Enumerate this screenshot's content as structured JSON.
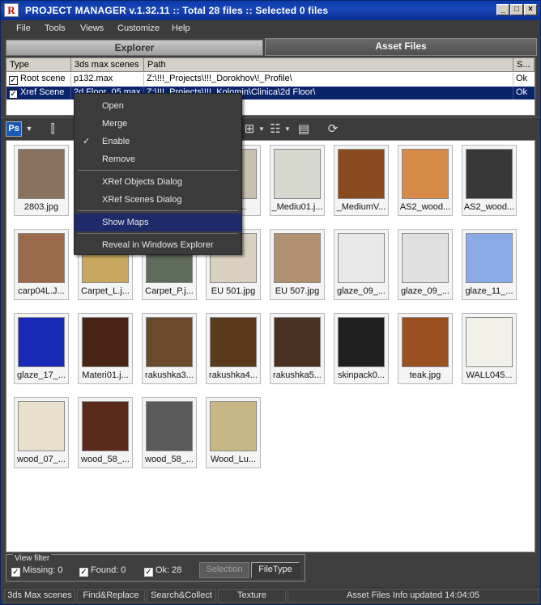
{
  "window": {
    "logo": "R",
    "title": "PROJECT MANAGER v.1.32.11   :: Total 28 files  :: Selected 0 files",
    "minimize": "_",
    "maximize": "□",
    "close": "×"
  },
  "menu": [
    "File",
    "Tools",
    "Views",
    "Customize",
    "Help"
  ],
  "tabs": {
    "explorer": "Explorer",
    "assets": "Asset Files"
  },
  "grid": {
    "columns": [
      "Type",
      "3ds max scenes",
      "Path",
      "S..."
    ],
    "rows": [
      {
        "type": "Root scene",
        "scene": "p132.max",
        "path": "Z:\\!!!_Projects\\!!!_Dorokhov\\!_Profile\\",
        "status": "Ok",
        "checked": "✓"
      },
      {
        "type": "Xref Scene",
        "scene": "2d Floor_05.max",
        "path": "Z:\\!!!_Projects\\!!!_Kolomin\\Clinica\\2d Floor\\",
        "status": "Ok",
        "checked": "✓"
      }
    ]
  },
  "toolbar": {
    "ps": "Ps",
    "icons": [
      "dropdown-icon",
      "mirror-icon",
      "grid-view-icon",
      "list-view-icon",
      "details-view-icon",
      "refresh-icon"
    ]
  },
  "context_menu": {
    "items": [
      "Open",
      "Merge",
      "Enable",
      "Remove",
      "XRef Objects Dialog",
      "XRef Scenes Dialog",
      "Show Maps",
      "Reveal in Windows Explorer"
    ],
    "tick": "✓",
    "highlighted": "Show Maps"
  },
  "thumbnails": [
    {
      "label": "2803.jpg",
      "color": "#8a735e"
    },
    {
      "label": "",
      "color": "#9a8e7a"
    },
    {
      "label": "",
      "color": "#6d7a55"
    },
    {
      "label": "...in.j...",
      "color": "#c8c0b0"
    },
    {
      "label": "_Mediu01.j...",
      "color": "#d6d8d0"
    },
    {
      "label": "_MediumV...",
      "color": "#8a4a20"
    },
    {
      "label": "AS2_wood...",
      "color": "#d88a48"
    },
    {
      "label": "AS2_wood...",
      "color": "#383838"
    },
    {
      "label": "carp04L.J...",
      "color": "#9a6a4a"
    },
    {
      "label": "Carpet_L.j...",
      "color": "#c8a860"
    },
    {
      "label": "Carpet_P.j...",
      "color": "#5e6a5a"
    },
    {
      "label": "EU 501.jpg",
      "color": "#d8d0c0"
    },
    {
      "label": "EU 507.jpg",
      "color": "#b09070"
    },
    {
      "label": "glaze_09_...",
      "color": "#e8e8e8"
    },
    {
      "label": "glaze_09_...",
      "color": "#e0e0e0"
    },
    {
      "label": "glaze_11_...",
      "color": "#8aaae8"
    },
    {
      "label": "glaze_17_...",
      "color": "#1a2ab8"
    },
    {
      "label": "Materi01.j...",
      "color": "#4a2414"
    },
    {
      "label": "rakushka3...",
      "color": "#6a4a2a"
    },
    {
      "label": "rakushka4...",
      "color": "#5a3a1a"
    },
    {
      "label": "rakushka5...",
      "color": "#4a3020"
    },
    {
      "label": "skinpack0...",
      "color": "#202020"
    },
    {
      "label": "teak.jpg",
      "color": "#9a5020"
    },
    {
      "label": "WALL045...",
      "color": "#f0f0e8"
    },
    {
      "label": "wood_07_...",
      "color": "#e8e0cc"
    },
    {
      "label": "wood_58_...",
      "color": "#5a2a1a"
    },
    {
      "label": "wood_58_...",
      "color": "#5a5a5a"
    },
    {
      "label": "Wood_Lu...",
      "color": "#c8b888"
    }
  ],
  "filter": {
    "title": "View filter",
    "missing": "Missing: 0",
    "found": "Found: 0",
    "ok": "Ok: 28",
    "selection_btn": "Selection",
    "filetype_btn": "FileType",
    "check": "✓"
  },
  "status": [
    "3ds Max scenes",
    "Find&Replace",
    "Search&Collect",
    "Texture",
    "Asset Files Info updated 14:04:05"
  ]
}
